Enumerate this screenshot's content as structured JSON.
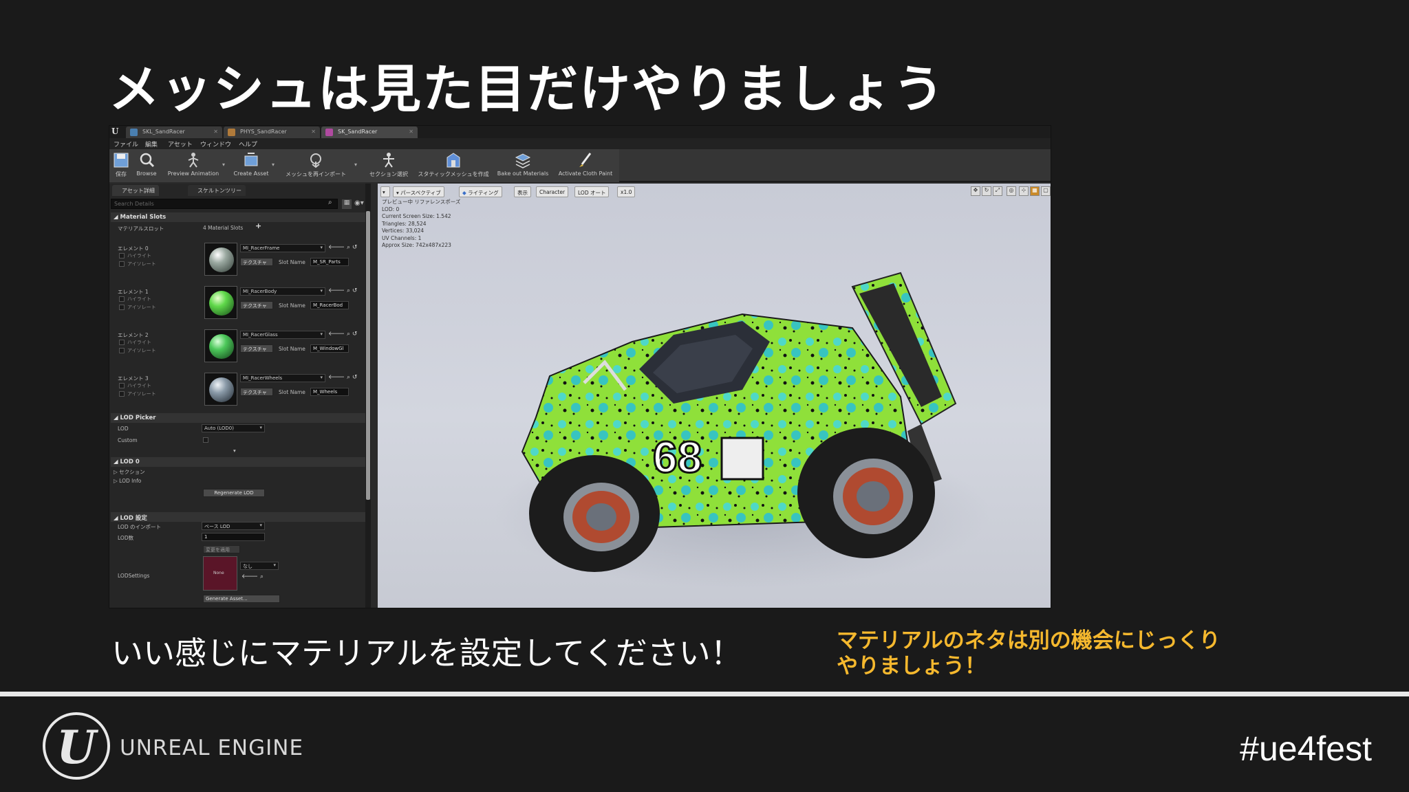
{
  "slide": {
    "title": "メッシュは見た目だけやりましょう",
    "caption": "いい感じにマテリアルを設定してください！",
    "note_line1": "マテリアルのネタは別の機会にじっくり",
    "note_line2": "やりましょう！",
    "brand": "UNREAL ENGINE",
    "hashtag": "#ue4fest",
    "logo_glyph": "U"
  },
  "editor": {
    "tabs": [
      {
        "label": "SKL_SandRacer",
        "color": "#4a7fb0"
      },
      {
        "label": "PHYS_SandRacer",
        "color": "#b07a3a"
      },
      {
        "label": "SK_SandRacer",
        "color": "#b04aa0"
      }
    ],
    "menu": [
      "ファイル",
      "編集",
      "アセット",
      "ウィンドウ",
      "ヘルプ"
    ],
    "toolbar": [
      {
        "label": "保存",
        "icon": "save-icon"
      },
      {
        "label": "Browse",
        "icon": "browse-icon"
      },
      {
        "label": "Preview Animation",
        "icon": "preview-animation-icon"
      },
      {
        "label": "Create Asset",
        "icon": "create-asset-icon"
      },
      {
        "label": "メッシュを再インポート",
        "icon": "reimport-icon"
      },
      {
        "label": "セクション選択",
        "icon": "section-select-icon"
      },
      {
        "label": "スタティックメッシュを作成",
        "icon": "static-mesh-icon"
      },
      {
        "label": "Bake out Materials",
        "icon": "bake-materials-icon"
      },
      {
        "label": "Activate Cloth Paint",
        "icon": "cloth-paint-icon"
      }
    ],
    "panel_tabs": {
      "details": "アセット詳細",
      "skeleton_tree": "スケルトンツリー"
    },
    "search_placeholder": "Search Details",
    "material_slots": {
      "header": "Material Slots",
      "label": "マテリアルスロット",
      "count": "4 Material Slots",
      "slot_name_label": "Slot Name",
      "texture_button": "テクスチャ",
      "highlight_label": "ハイライト",
      "isolate_label": "アイソレート",
      "elements": [
        {
          "label": "エレメント 0",
          "material": "MI_RacerFrame",
          "slot_name": "M_SR_Parts",
          "tint": "#9aa8a0"
        },
        {
          "label": "エレメント 1",
          "material": "MI_RacerBody",
          "slot_name": "M_RacerBod",
          "tint": "#5fd84a"
        },
        {
          "label": "エレメント 2",
          "material": "MI_RacerGlass",
          "slot_name": "M_WindowGl",
          "tint": "#4cc85a"
        },
        {
          "label": "エレメント 3",
          "material": "MI_RacerWheels",
          "slot_name": "M_Wheels",
          "tint": "#8a9aa8"
        }
      ]
    },
    "lod_picker": {
      "header": "LOD Picker",
      "lod_label": "LOD",
      "lod_value": "Auto (LOD0)",
      "custom_label": "Custom"
    },
    "lod0": {
      "header": "LOD 0",
      "sections": "セクション",
      "lod_info": "LOD Info",
      "regenerate": "Regenerate LOD"
    },
    "lod_settings": {
      "header": "LOD 設定",
      "import_label": "LOD のインポート",
      "import_value": "ベース LOD",
      "count_label": "LOD数",
      "count_value": "1",
      "apply_button": "変更を適用",
      "settings_label": "LODSettings",
      "settings_value": "なし",
      "thumb_text": "None",
      "generate_button": "Generate Asset..."
    },
    "viewport": {
      "buttons": [
        "パースペクティブ",
        "ライティング",
        "表示",
        "Character",
        "LOD オート",
        "x1.0"
      ],
      "stats": [
        "プレビュー中 リファレンスポーズ",
        "LOD: 0",
        "Current Screen Size: 1.542",
        "Triangles: 28,524",
        "Vertices: 33,024",
        "UV Channels: 1",
        "Approx Size: 742x487x223"
      ]
    }
  }
}
